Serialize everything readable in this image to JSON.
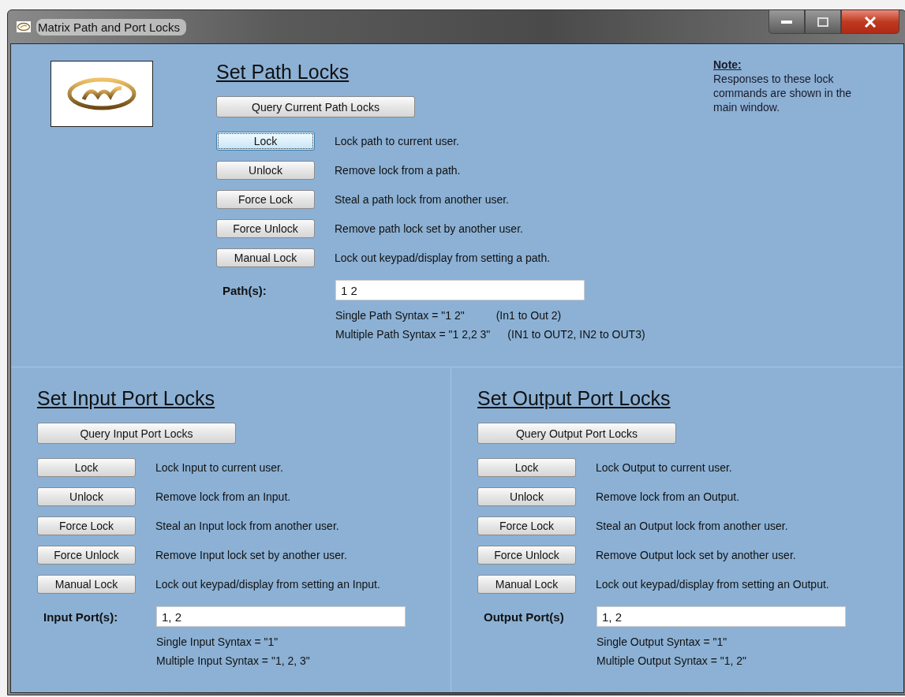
{
  "window": {
    "title": "Matrix Path and Port Locks"
  },
  "path_section": {
    "title": "Set Path Locks",
    "query_button": "Query Current Path Locks",
    "actions": [
      {
        "button": "Lock",
        "description": "Lock path to current user.",
        "focused": true
      },
      {
        "button": "Unlock",
        "description": "Remove lock from a path.",
        "focused": false
      },
      {
        "button": "Force Lock",
        "description": "Steal a path lock from another user.",
        "focused": false
      },
      {
        "button": "Force Unlock",
        "description": "Remove path lock set by another user.",
        "focused": false
      },
      {
        "button": "Manual Lock",
        "description": "Lock out keypad/display from setting a path.",
        "focused": false
      }
    ],
    "field": {
      "label": "Path(s):",
      "value": "1 2"
    },
    "syntax": [
      {
        "text": "Single Path Syntax = \"1 2\"",
        "example": "(In1 to Out  2)"
      },
      {
        "text": "Multiple Path Syntax = \"1 2,2 3\"",
        "example": "(IN1 to OUT2, IN2 to OUT3)"
      }
    ]
  },
  "note": {
    "heading": "Note:",
    "text": "Responses to these lock commands are shown in the main window."
  },
  "port_sections": [
    {
      "title": "Set Input Port Locks",
      "query_button": "Query Input Port Locks",
      "actions": [
        {
          "button": "Lock",
          "description": "Lock Input to current user.",
          "focused": false
        },
        {
          "button": "Unlock",
          "description": "Remove lock from an Input.",
          "focused": false
        },
        {
          "button": "Force Lock",
          "description": "Steal an Input lock from another user.",
          "focused": false
        },
        {
          "button": "Force Unlock",
          "description": "Remove Input lock set by another user.",
          "focused": false
        },
        {
          "button": "Manual Lock",
          "description": "Lock out keypad/display from setting an Input.",
          "focused": false
        }
      ],
      "field": {
        "label": "Input Port(s):",
        "value": "1, 2"
      },
      "syntax": [
        {
          "text": "Single Input Syntax = \"1\""
        },
        {
          "text": "Multiple Input Syntax = \"1, 2, 3\""
        }
      ]
    },
    {
      "title": "Set Output Port Locks",
      "query_button": "Query Output Port Locks",
      "actions": [
        {
          "button": "Lock",
          "description": "Lock Output to current user.",
          "focused": false
        },
        {
          "button": "Unlock",
          "description": "Remove lock from an Output.",
          "focused": false
        },
        {
          "button": "Force Lock",
          "description": "Steal an Output lock from another user.",
          "focused": false
        },
        {
          "button": "Force Unlock",
          "description": "Remove Output lock set by another user.",
          "focused": false
        },
        {
          "button": "Manual Lock",
          "description": "Lock out keypad/display from setting an Output.",
          "focused": false
        }
      ],
      "field": {
        "label": "Output Port(s)",
        "value": "1, 2"
      },
      "syntax": [
        {
          "text": "Single Output Syntax = \"1\""
        },
        {
          "text": "Multiple Output Syntax = \"1, 2\""
        }
      ]
    }
  ]
}
